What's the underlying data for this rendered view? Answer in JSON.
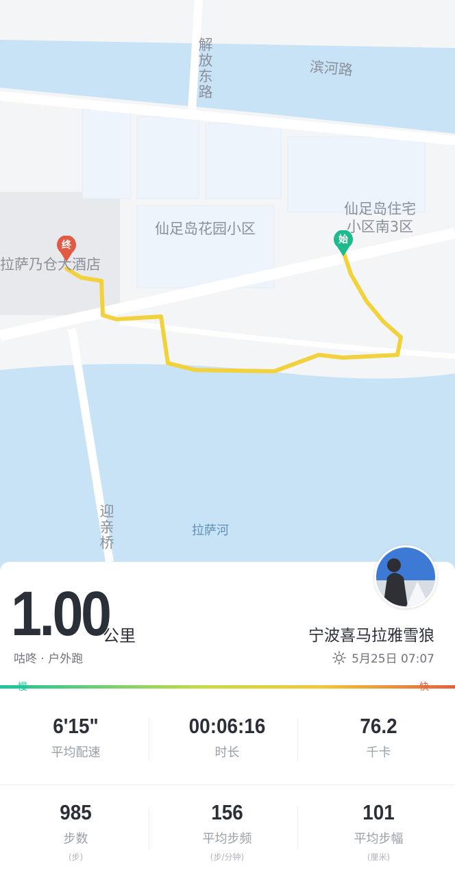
{
  "map": {
    "labels": {
      "jiefang_road": "解放东路",
      "binhe_road": "滨河路",
      "xianzu_garden": "仙足岛花园小区",
      "xianzu_south": "仙足岛住宅小区南3区",
      "hotel": "拉萨乃仓大酒店",
      "yingqin_bridge": "迎亲桥",
      "lhasa_river": "拉萨河"
    },
    "start_pin": "始",
    "end_pin": "终",
    "route_color": "#f1d23c",
    "water_color": "#c9e3f6",
    "land_color": "#f4f5f7"
  },
  "run": {
    "distance": "1.00",
    "unit": "公里",
    "source": "咕咚 · 户外跑",
    "username": "宁波喜马拉雅雪狼",
    "datetime": "5月25日 07:07",
    "weather_icon": "sun-icon"
  },
  "pace_bar": {
    "slow": "慢",
    "fast": "快",
    "slow_color": "#1bc49a",
    "fast_color": "#e2623f"
  },
  "stats": {
    "row1": [
      {
        "value": "6'15\"",
        "label": "平均配速"
      },
      {
        "value": "00:06:16",
        "label": "时长"
      },
      {
        "value": "76.2",
        "label": "千卡"
      }
    ],
    "row2": [
      {
        "value": "985",
        "label": "步数",
        "unit": "(步)"
      },
      {
        "value": "156",
        "label": "平均步频",
        "unit": "(步/分钟)"
      },
      {
        "value": "101",
        "label": "平均步幅",
        "unit": "(厘米)"
      }
    ]
  }
}
